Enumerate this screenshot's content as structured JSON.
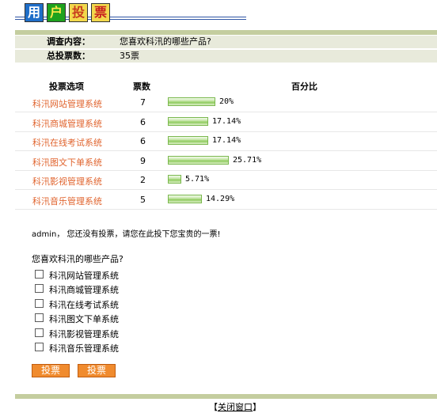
{
  "header": {
    "title_chars": [
      "用",
      "户",
      "投",
      "票"
    ]
  },
  "info": {
    "survey_label": "调查内容：",
    "survey_value": "您喜欢科汛的哪些产品?",
    "total_label": "总投票数：",
    "total_value": "35票"
  },
  "table": {
    "col_option": "投票选项",
    "col_count": "票数",
    "col_percent": "百分比"
  },
  "chart_data": {
    "type": "bar",
    "categories": [
      "科汛网站管理系统",
      "科汛商城管理系统",
      "科汛在线考试系统",
      "科汛图文下单系统",
      "科汛影视管理系统",
      "科汛音乐管理系统"
    ],
    "series": [
      {
        "name": "票数",
        "values": [
          7,
          6,
          6,
          9,
          2,
          5
        ]
      }
    ],
    "percent_labels": [
      "20%",
      "17.14%",
      "17.14%",
      "25.71%",
      "5.71%",
      "14.29%"
    ],
    "percent_values": [
      20,
      17.14,
      17.14,
      25.71,
      5.71,
      14.29
    ]
  },
  "notice": "admin， 您还没有投票，请您在此投下您宝贵的一票!",
  "vote_form": {
    "question": "您喜欢科汛的哪些产品?",
    "options": [
      "科汛网站管理系统",
      "科汛商城管理系统",
      "科汛在线考试系统",
      "科汛图文下单系统",
      "科汛影视管理系统",
      "科汛音乐管理系统"
    ],
    "button1": "投票",
    "button2": "投票"
  },
  "footer": {
    "open_bracket": "【",
    "close_link": "关闭窗口",
    "close_bracket": "】"
  },
  "colors": {
    "accent_orange": "#e0642e",
    "button_orange": "#f08b2e",
    "bar_olive": "#c4cd9f",
    "bar_green": "#8fcb5e"
  }
}
